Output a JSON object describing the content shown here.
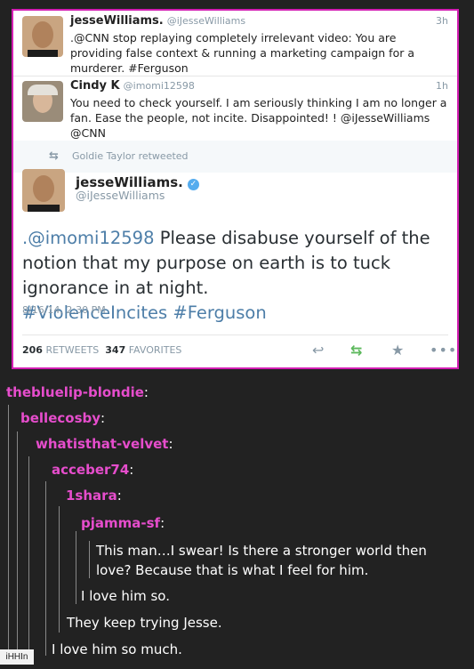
{
  "tweets": [
    {
      "name": "jesseWilliams.",
      "handle": "@iJesseWilliams",
      "time": "3h",
      "text": ".@CNN stop replaying completely irrelevant video: You are providing false context & running a marketing campaign for a murderer. #Ferguson"
    },
    {
      "name": "Cindy K",
      "handle": "@imomi12598",
      "time": "1h",
      "text": "You need to check yourself. I am seriously thinking I am no longer a fan. Ease the people, not incite. Disappointed! ! @iJesseWilliams @CNN"
    }
  ],
  "retweet_bar": {
    "text": "Goldie Taylor retweeted"
  },
  "main_tweet": {
    "name": "jesseWilliams.",
    "handle": "@iJesseWilliams",
    "mention": ".@imomi12598",
    "body": " Please disabuse yourself of the notion that my purpose on earth is to tuck ignorance in at night. ",
    "hashtag1": "#ViolenceIncites",
    "hashtag2": "#Ferguson",
    "date": "8/16/14, 2:30 PM",
    "retweets_count": "206",
    "retweets_label": "RETWEETS",
    "favorites_count": "347",
    "favorites_label": "FAVORITES"
  },
  "icons": {
    "reply": "reply-icon",
    "retweet": "retweet-icon",
    "favorite": "star-icon",
    "more": "more-icon",
    "verified": "verified-icon"
  },
  "colors": {
    "frame_border": "#d31eb3",
    "username": "#e64dcc",
    "link_blue": "#4d7ea8",
    "background": "#222222"
  },
  "reblogs": [
    {
      "user": "thebluelip-blondie",
      "text": ""
    },
    {
      "user": "bellecosby",
      "text": ""
    },
    {
      "user": "whatisthat-velvet",
      "text": ""
    },
    {
      "user": "acceber74",
      "text": ""
    },
    {
      "user": "1shara",
      "text": ""
    },
    {
      "user": "pjamma-sf",
      "text": ""
    },
    {
      "user": "",
      "text": "This man…I swear! Is there a stronger world then love? Because that is what I feel for him."
    },
    {
      "user": "",
      "text": "I love him so."
    },
    {
      "user": "",
      "text": "They keep trying Jesse."
    },
    {
      "user": "",
      "text": "I love him so much."
    }
  ],
  "badge": "iHHIn"
}
